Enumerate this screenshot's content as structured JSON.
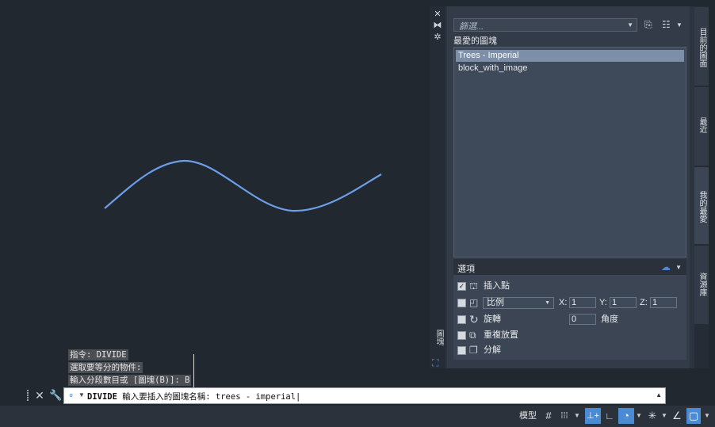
{
  "history": {
    "line1": "指令: DIVIDE",
    "line2": "選取要等分的物件:",
    "line3": "輸入分段數目或 [圖塊(B)]: B"
  },
  "command": {
    "cmd_name": "DIVIDE",
    "prompt": " 輸入要插入的圖塊名稱: trees - imperial"
  },
  "status": {
    "model_label": "模型"
  },
  "palette": {
    "strip_title": "圖塊",
    "filter_placeholder": "篩選...",
    "section_title": "最愛的圖塊",
    "items": [
      "Trees - Imperial",
      "block_with_image"
    ],
    "options": {
      "title": "選項",
      "insert_point": "插入點",
      "scale_label": "比例",
      "x_label": "X:",
      "x_value": "1",
      "y_label": "Y:",
      "y_value": "1",
      "z_label": "Z:",
      "z_value": "1",
      "rotate_label": "旋轉",
      "angle_value": "0",
      "angle_label": "角度",
      "repeat_label": "重複放置",
      "explode_label": "分解"
    },
    "tabs": [
      "目前的圖面",
      "最近",
      "我的最愛",
      "資源庫"
    ]
  },
  "colors": {
    "canvas": "#212830",
    "curve": "#6d9ee8",
    "accent": "#4a8bd6",
    "selected_item": "#7d8fa8"
  }
}
